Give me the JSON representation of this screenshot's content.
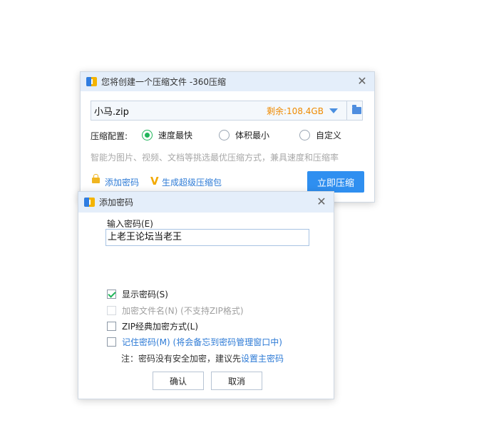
{
  "main_dialog": {
    "title": "您将创建一个压缩文件 -360压缩",
    "filename": "小马.zip",
    "free_space": "剩余:108.4GB",
    "config_label": "压缩配置:",
    "options": [
      "速度最快",
      "体积最小",
      "自定义"
    ],
    "selected_option": "速度最快",
    "description": "智能为图片、视频、文档等挑选最优压缩方式，兼具速度和压缩率",
    "add_password_link": "添加密码",
    "generate_link": "生成超级压缩包",
    "compress_button": "立即压缩",
    "accent_color": "#2f8ff0",
    "space_color": "#ef8a00"
  },
  "password_dialog": {
    "title": "添加密码",
    "input_label": "输入密码(E)",
    "password_value": "上老王论坛当老王",
    "checkboxes": [
      {
        "label": "显示密码(S)",
        "checked": true,
        "disabled": false
      },
      {
        "label": "加密文件名(N) (不支持ZIP格式)",
        "checked": false,
        "disabled": true
      },
      {
        "label": "ZIP经典加密方式(L)",
        "checked": false,
        "disabled": false
      },
      {
        "label": "记住密码(M) (将会备忘到密码管理窗口中)",
        "checked": false,
        "disabled": false
      }
    ],
    "note_prefix": "注：密码没有安全加密，建议先",
    "note_link": "设置主密码",
    "ok_button": "确认",
    "cancel_button": "取消"
  }
}
